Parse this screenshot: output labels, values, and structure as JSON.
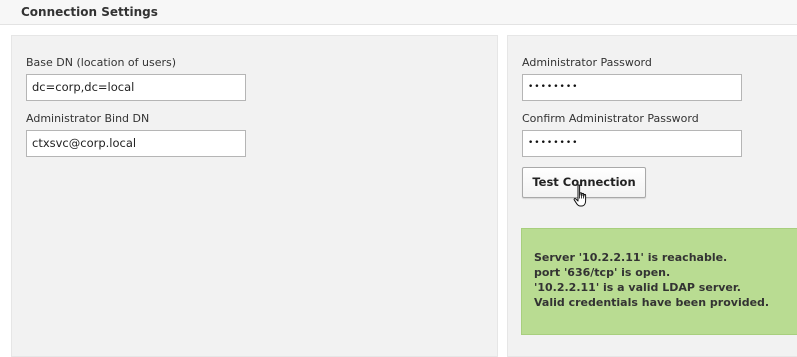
{
  "header": {
    "title": "Connection Settings"
  },
  "form": {
    "base_dn": {
      "label": "Base DN (location of users)",
      "value": "dc=corp,dc=local"
    },
    "bind_dn": {
      "label": "Administrator Bind DN",
      "value": "ctxsvc@corp.local"
    },
    "admin_password": {
      "label": "Administrator Password",
      "masked_value": "••••••••"
    },
    "confirm_password": {
      "label": "Confirm Administrator Password",
      "masked_value": "••••••••"
    },
    "test_button_label": "Test Connection"
  },
  "status": {
    "color": "#b9dc92",
    "lines": [
      "Server '10.2.2.11' is reachable.",
      "port '636/tcp' is open.",
      "'10.2.2.11' is a valid LDAP server.",
      "Valid credentials have been provided."
    ]
  },
  "icons": {
    "cursor": "hand-pointer-icon"
  }
}
